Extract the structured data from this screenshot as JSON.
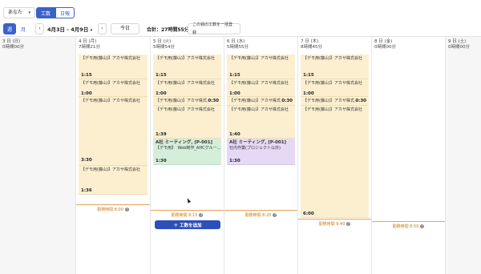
{
  "toolbar": {
    "user_select": "あなた",
    "mode_tabs": [
      "工数",
      "日報"
    ],
    "view_tabs": [
      "週",
      "月"
    ],
    "date_range": "4月3日 - 4月9日",
    "today_label": "今日",
    "total_label": "合計：27時間55分",
    "bulk_register_label": "この週の工数を一括登録"
  },
  "days": [
    {
      "label": "3 日 (日)",
      "total": "0時間00分"
    },
    {
      "label": "4 日 (月)",
      "total": "7時間21分"
    },
    {
      "label": "5 日 (火)",
      "total": "5時間54分"
    },
    {
      "label": "6 日 (水)",
      "total": "5時間55分"
    },
    {
      "label": "7 日 (木)",
      "total": "8時間45分"
    },
    {
      "label": "8 日 (金)",
      "total": "0時間00分"
    },
    {
      "label": "9 日 (土)",
      "total": "0時間00分"
    }
  ],
  "event_title": "【デモ用(藤山)】アカサ株式会社",
  "event_title_short": "【デモ用(藤山)】アカサ株式...",
  "durations": {
    "mon": [
      "1:15",
      "1:00",
      "3:30",
      "1:36"
    ],
    "tue": [
      "1:15",
      "1:00",
      "0:30",
      "1:39",
      "1:30"
    ],
    "wed": [
      "1:15",
      "1:00",
      "0:30",
      "1:40",
      "1:30"
    ],
    "thu": [
      "1:15",
      "1:00",
      "0:30",
      "6:00"
    ]
  },
  "meeting_a": {
    "title": "A社 ミーティング, [P-001]",
    "sub": "【デモ用】　Web制作_AHCグルー..."
  },
  "meeting_b": {
    "title": "A社 ミーティング, [P-001]",
    "sub": "社内作業(プロジェクト以外)"
  },
  "work_hours": {
    "mon": "勤務時間 8:00",
    "tue": "勤務時間 8:15",
    "wed": "勤務時間 8:20",
    "thu": "勤務時間 9:40",
    "fri": "勤務時間 8:50"
  },
  "add_button_label": "＋ 工数を追加",
  "colors": {
    "accent": "#3a61c9",
    "event": "#fbefd0",
    "green_event": "#d5eeda",
    "purple_event": "#e6d9f6",
    "work_hours_text": "#c97a12"
  }
}
